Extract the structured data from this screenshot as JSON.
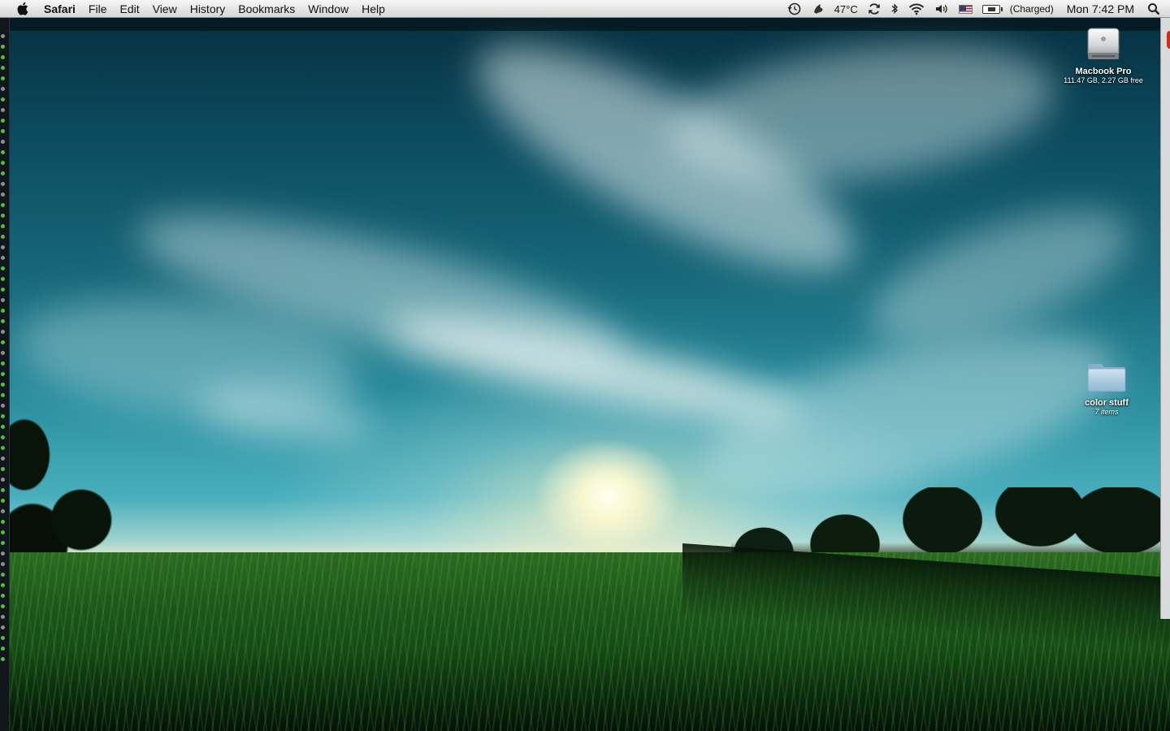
{
  "menubar": {
    "apple_icon": "apple-icon",
    "app_name": "Safari",
    "menus": [
      "File",
      "Edit",
      "View",
      "History",
      "Bookmarks",
      "Window",
      "Help"
    ],
    "status": {
      "temperature": "47°C",
      "battery_status": "(Charged)",
      "clock": "Mon 7:42 PM",
      "icons": [
        "timemachine-icon",
        "growl-icon",
        "sync-icon",
        "bluetooth-icon",
        "wifi-icon",
        "volume-icon",
        "us-flag-icon",
        "battery-icon",
        "spotlight-icon"
      ]
    }
  },
  "desktop": {
    "icons": [
      {
        "name": "Macbook Pro",
        "sub": "111.47 GB, 2.27 GB free",
        "icon": "hard-drive-icon"
      },
      {
        "name": "color stuff",
        "sub": "7 items",
        "icon": "folder-icon"
      }
    ]
  },
  "colors": {
    "menubar_top": "#f7f7f7",
    "menubar_bottom": "#d6d6d6",
    "folder_blue": "#9fc3dd",
    "sky": "#2b8fa0",
    "grass": "#1f5a1c"
  }
}
